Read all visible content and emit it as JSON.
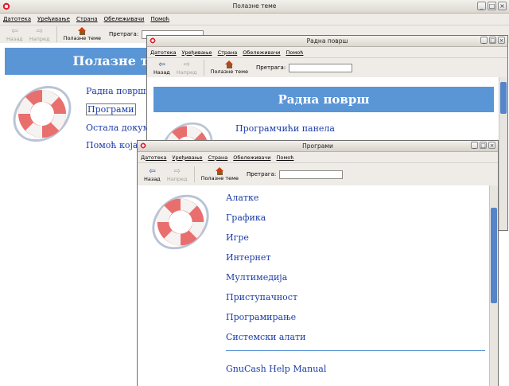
{
  "win1": {
    "title": "Полазне теме",
    "menu": [
      "Датотека",
      "Уређивање",
      "Страна",
      "Обележивачи",
      "Помоћ"
    ],
    "toolbar": {
      "back": "Назад",
      "forward": "Напред",
      "home": "Полазне теме",
      "search_label": "Претрага:"
    },
    "banner": "Полазне теме",
    "links": [
      "Радна површ",
      "Програми",
      "Остала документа",
      "Помоћ која"
    ]
  },
  "win2": {
    "title": "Радна површ",
    "menu": [
      "Датотека",
      "Уређивање",
      "Страна",
      "Обележивачи",
      "Помоћ"
    ],
    "toolbar": {
      "back": "Назад",
      "forward": "Напред",
      "home": "Полазне теме",
      "search_label": "Претрага:"
    },
    "banner": "Радна површ",
    "links": [
      "Програмчићи панела"
    ]
  },
  "win3": {
    "title": "Програми",
    "menu": [
      "Датотека",
      "Уређивање",
      "Страна",
      "Обележивачи",
      "Помоћ"
    ],
    "toolbar": {
      "back": "Назад",
      "forward": "Напред",
      "home": "Полазне теме",
      "search_label": "Претрага:"
    },
    "links": [
      "Алатке",
      "Графика",
      "Игре",
      "Интернет",
      "Мултимедија",
      "Приступачност",
      "Програмирање",
      "Системски алати"
    ],
    "extra_link": "GnuCash Help Manual"
  },
  "colors": {
    "banner": "#5a95d6",
    "link": "#1a3ca8",
    "scroll_thumb": "#5584c9"
  }
}
